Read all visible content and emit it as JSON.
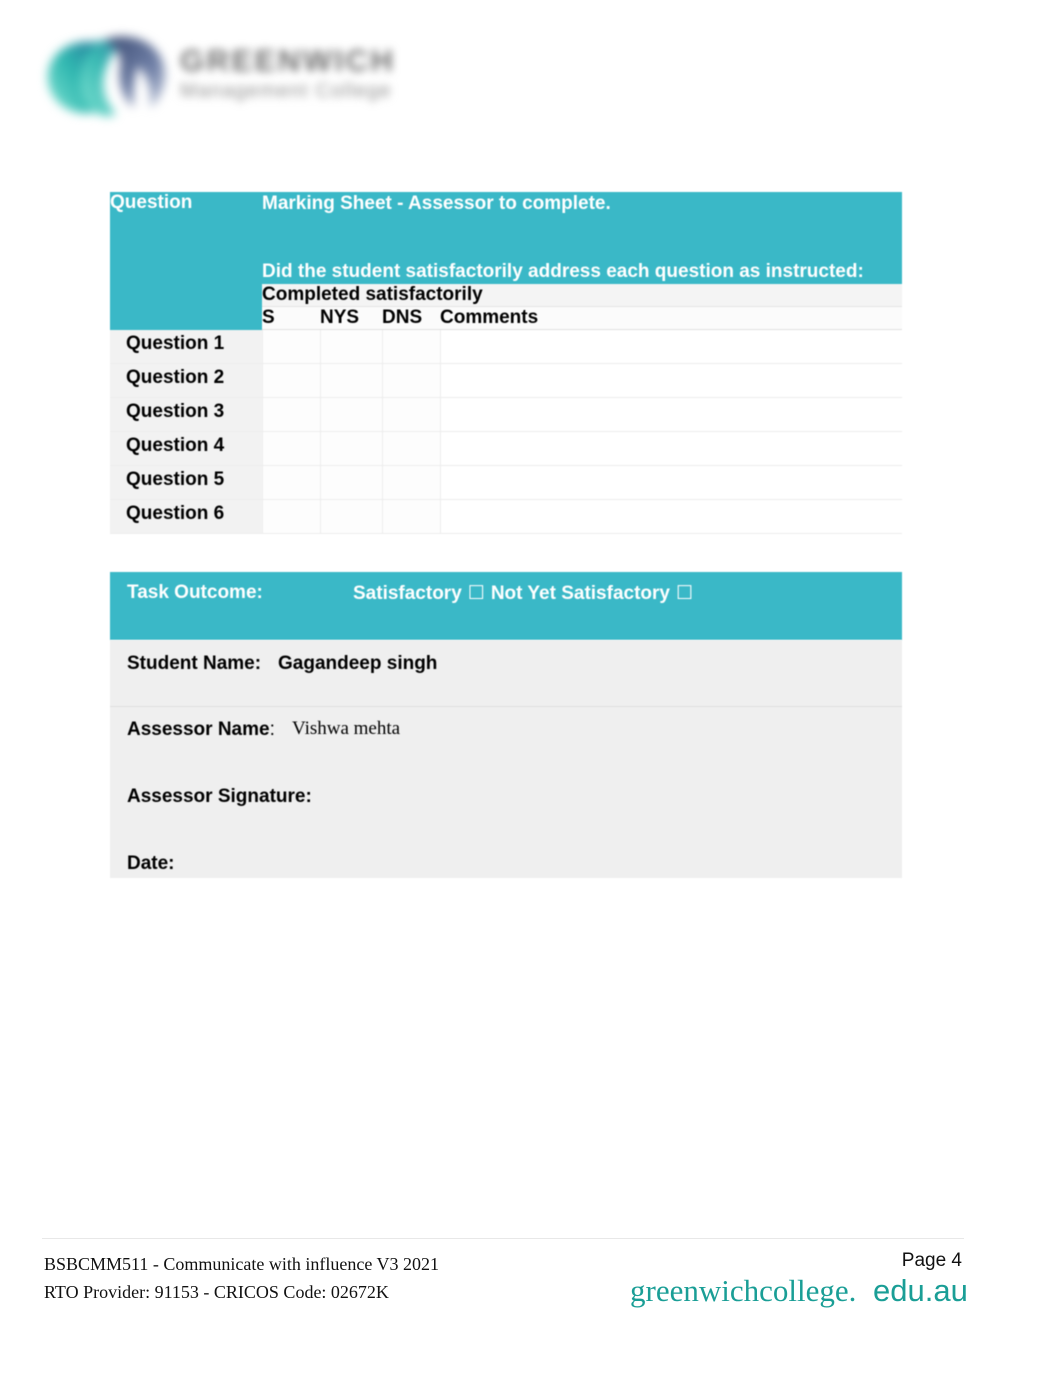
{
  "document": {
    "title": "Marking Sheet - Assessor to complete."
  },
  "header": {
    "logo_icon": "greenwich-gm-logo-icon",
    "wordmark_line1": "GREENWICH",
    "wordmark_line2": "Management College"
  },
  "marking_table": {
    "question_column_header": "Question",
    "main_header": "Marking Sheet - Assessor to complete.",
    "main_subheader": "Did the student satisfactorily address each question as instructed:",
    "completed_label": "Completed satisfactorily",
    "columns": [
      "S",
      "NYS",
      "DNS",
      "Comments"
    ],
    "rows": [
      {
        "label": "Question 1",
        "s": "",
        "nys": "",
        "dns": "",
        "comments": ""
      },
      {
        "label": "Question 2",
        "s": "",
        "nys": "",
        "dns": "",
        "comments": ""
      },
      {
        "label": "Question 3",
        "s": "",
        "nys": "",
        "dns": "",
        "comments": ""
      },
      {
        "label": "Question 4",
        "s": "",
        "nys": "",
        "dns": "",
        "comments": ""
      },
      {
        "label": "Question 5",
        "s": "",
        "nys": "",
        "dns": "",
        "comments": ""
      },
      {
        "label": "Question 6",
        "s": "",
        "nys": "",
        "dns": "",
        "comments": ""
      }
    ]
  },
  "task_outcome": {
    "label": "Task Outcome:",
    "option_satisfactory": "Satisfactory",
    "option_not_yet_satisfactory": "Not Yet Satisfactory",
    "checkbox_glyph": "☐"
  },
  "details": {
    "student_name_label": "Student Name:",
    "student_name_value": "Gagandeep singh",
    "assessor_name_label": "Assessor Name",
    "assessor_name_colon": ":",
    "assessor_name_value": "Vishwa mehta",
    "assessor_signature_label": "Assessor Signature:",
    "date_label": "Date:"
  },
  "footer": {
    "unit_line": "BSBCMM511 - Communicate with influence V3 2021",
    "rto_line": "RTO Provider: 91153     - CRICOS   Code: 02672K",
    "page_label": "Page 4",
    "brand_primary": "greenwichcollege.",
    "brand_domain": "edu.au"
  },
  "colors": {
    "teal_header": "#3ab8c7",
    "brand_teal": "#1a9e96",
    "details_background": "#efefef",
    "row_label_background": "#f2f2f2"
  }
}
